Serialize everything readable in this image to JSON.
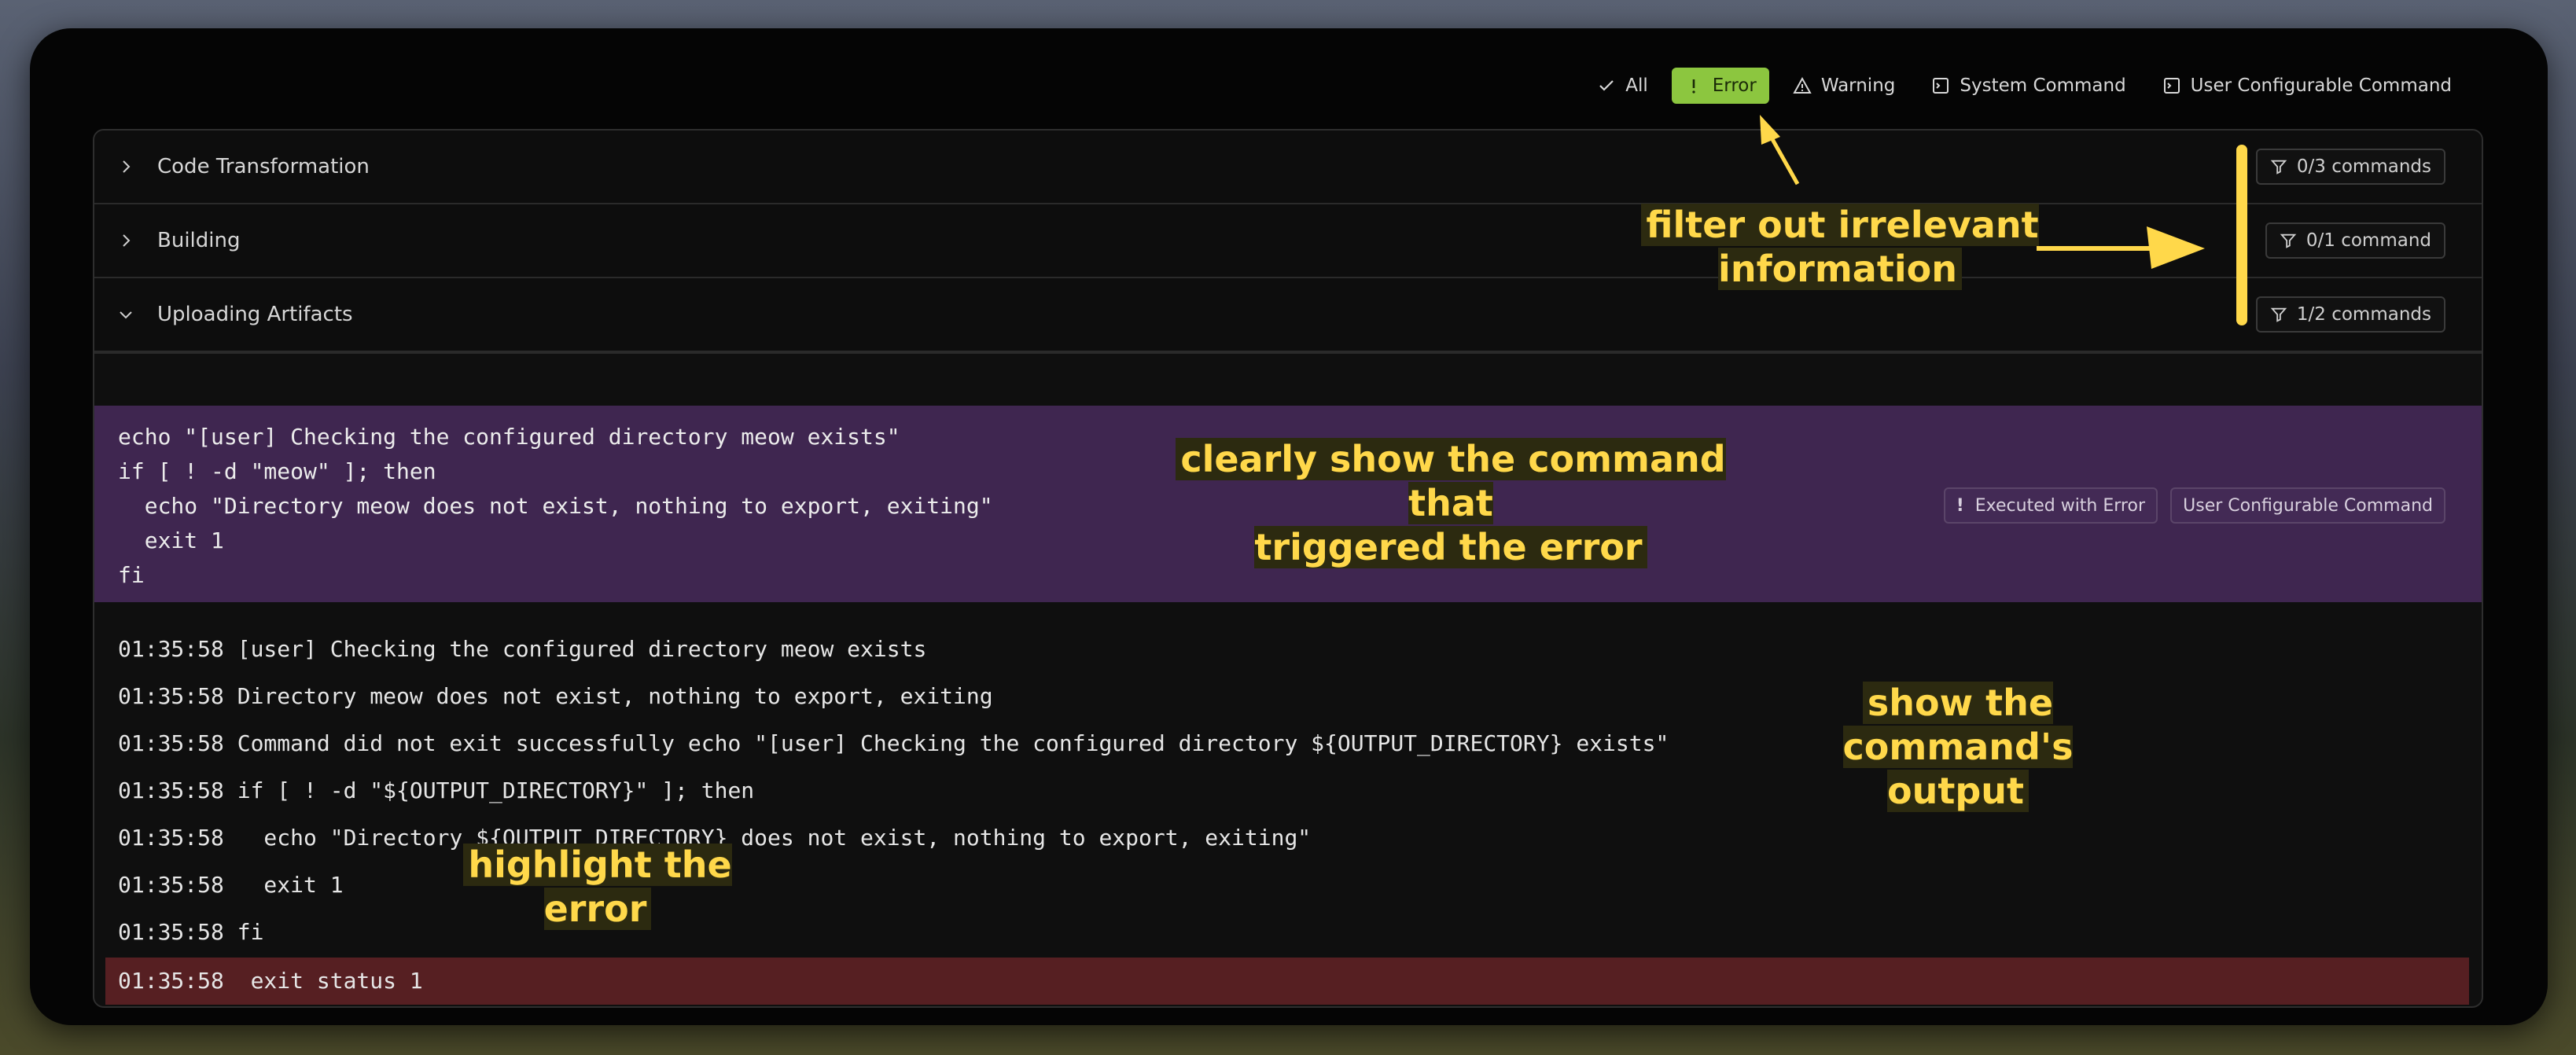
{
  "filters": [
    {
      "label": "All",
      "icon": "check-icon",
      "active": false
    },
    {
      "label": "Error",
      "icon": "exclamation-icon",
      "active": true
    },
    {
      "label": "Warning",
      "icon": "warning-triangle-icon",
      "active": false
    },
    {
      "label": "System Command",
      "icon": "terminal-icon",
      "active": false
    },
    {
      "label": "User Configurable Command",
      "icon": "terminal-icon",
      "active": false
    }
  ],
  "sections": [
    {
      "title": "Code Transformation",
      "expanded": false,
      "count": "0/3 commands"
    },
    {
      "title": "Building",
      "expanded": false,
      "count": "0/1 command"
    },
    {
      "title": "Uploading Artifacts",
      "expanded": true,
      "count": "1/2 commands"
    }
  ],
  "command_block": {
    "code": "echo \"[user] Checking the configured directory meow exists\"\nif [ ! -d \"meow\" ]; then\n  echo \"Directory meow does not exist, nothing to export, exiting\"\n  exit 1\nfi",
    "status_tag": "Executed with Error",
    "type_tag": "User Configurable Command"
  },
  "output_lines": [
    "01:35:58 [user] Checking the configured directory meow exists",
    "01:35:58 Directory meow does not exist, nothing to export, exiting",
    "01:35:58 Command did not exit successfully echo \"[user] Checking the configured directory ${OUTPUT_DIRECTORY} exists\"",
    "01:35:58 if [ ! -d \"${OUTPUT_DIRECTORY}\" ]; then",
    "01:35:58   echo \"Directory ${OUTPUT_DIRECTORY} does not exist, nothing to export, exiting\"",
    "01:35:58   exit 1",
    "01:35:58 fi"
  ],
  "error_line": "01:35:58  exit status 1",
  "annotations": {
    "filter": "filter out irrelevant\ninformation",
    "command": "clearly show the command that\ntriggered the error",
    "output": "show the\ncommand's\noutput",
    "highlight": "highlight the error"
  },
  "colors": {
    "active_filter": "#8cc63f",
    "command_bg": "#3f2650",
    "error_bg": "#561f22",
    "annotation": "#ffd84a"
  }
}
